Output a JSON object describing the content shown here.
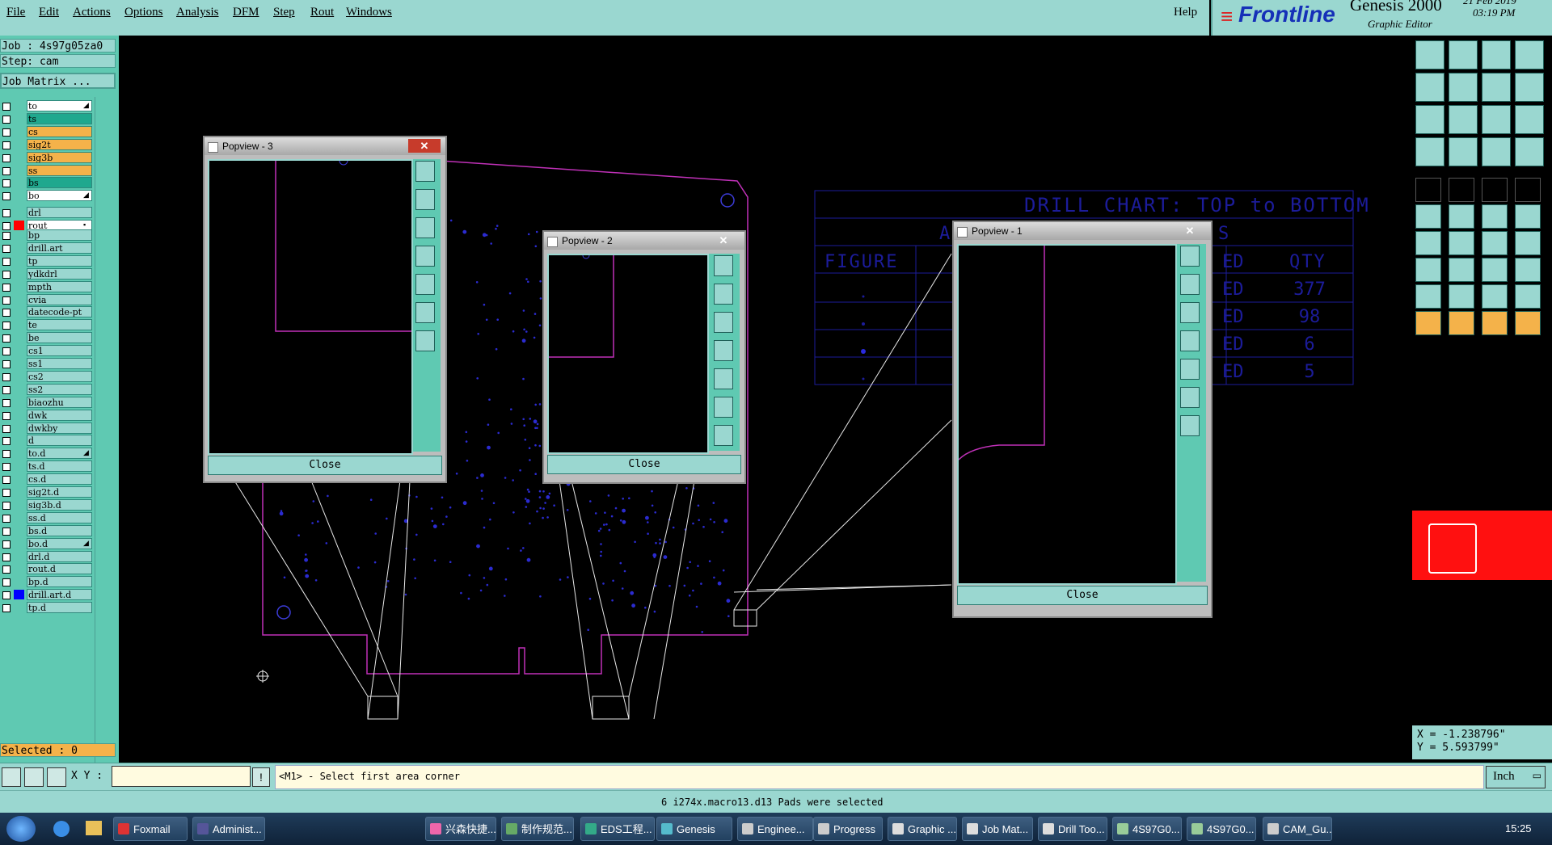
{
  "menubar": {
    "items": [
      "File",
      "Edit",
      "Actions",
      "Options",
      "Analysis",
      "DFM",
      "Step",
      "Rout",
      "Windows"
    ],
    "help": "Help"
  },
  "brand": {
    "logo": "Frontline",
    "product": "Genesis 2000",
    "subtitle": "Graphic Editor",
    "date": "21 Feb 2019",
    "time": "03:19 PM"
  },
  "left_panel": {
    "job": "Job : 4s97g05za0",
    "step": "Step: cam",
    "job_matrix": "Job Matrix ...",
    "selected": "Selected : 0",
    "layers_top": [
      {
        "name": "to",
        "color": "#ffffff",
        "marker": "◢"
      },
      {
        "name": "ts",
        "color": "#1fa88e"
      },
      {
        "name": "cs",
        "color": "#f4b24a"
      },
      {
        "name": "sig2t",
        "color": "#f4b24a"
      },
      {
        "name": "sig3b",
        "color": "#f4b24a"
      },
      {
        "name": "ss",
        "color": "#f4b24a"
      },
      {
        "name": "bs",
        "color": "#1fa88e"
      },
      {
        "name": "bo",
        "color": "#ffffff",
        "marker": "◢"
      }
    ],
    "layers_drill": [
      {
        "name": "drl",
        "color": "#9ad7d0"
      },
      {
        "name": "rout",
        "color": "#ffffff",
        "active": "#ff0000",
        "marker": "▪"
      }
    ],
    "layers_other": [
      {
        "name": "bp"
      },
      {
        "name": "drill.art"
      },
      {
        "name": "tp"
      },
      {
        "name": "ydkdrl"
      },
      {
        "name": "mpth"
      },
      {
        "name": "cvia"
      },
      {
        "name": "datecode-pt"
      },
      {
        "name": "te"
      },
      {
        "name": "be"
      },
      {
        "name": "cs1"
      },
      {
        "name": "ss1"
      },
      {
        "name": "cs2"
      },
      {
        "name": "ss2"
      },
      {
        "name": "biaozhu"
      },
      {
        "name": "dwk"
      },
      {
        "name": "dwkby"
      },
      {
        "name": "d"
      },
      {
        "name": "to.d",
        "marker": "◢"
      },
      {
        "name": "ts.d"
      },
      {
        "name": "cs.d"
      },
      {
        "name": "sig2t.d"
      },
      {
        "name": "sig3b.d"
      },
      {
        "name": "ss.d"
      },
      {
        "name": "bs.d"
      },
      {
        "name": "bo.d",
        "marker": "◢"
      },
      {
        "name": "drl.d"
      },
      {
        "name": "rout.d"
      },
      {
        "name": "bp.d"
      },
      {
        "name": "drill.art.d",
        "active": "#0000ff"
      },
      {
        "name": "tp.d"
      }
    ]
  },
  "drill_chart": {
    "title": "DRILL CHART: TOP to BOTTOM",
    "header_partial_left": "A",
    "header_partial_right": "S",
    "col_figure": "FIGURE",
    "col_ed": "ED",
    "col_qty": "QTY",
    "rows": [
      {
        "ed": "ED",
        "qty": "377"
      },
      {
        "ed": "ED",
        "qty": "98"
      },
      {
        "ed": "ED",
        "qty": "6"
      },
      {
        "ed": "ED",
        "qty": "5"
      }
    ]
  },
  "popviews": [
    {
      "title": "Popview - 3",
      "close": "Close"
    },
    {
      "title": "Popview - 2",
      "close": "Close"
    },
    {
      "title": "Popview - 1",
      "close": "Close"
    }
  ],
  "coords": {
    "x": "X = -1.238796\"",
    "y": "Y = 5.593799\""
  },
  "cmdbar": {
    "xy_label": "X Y :",
    "xy_value": "",
    "prompt": "<M1> - Select first area corner",
    "units": "Inch"
  },
  "status": "6 i274x.macro13.d13 Pads were selected",
  "taskbar": {
    "items": [
      "Foxmail",
      "Administ...",
      "兴森快捷...",
      "制作规范...",
      "EDS工程...",
      "Genesis",
      "Enginee...",
      "Progress",
      "Graphic ...",
      "Job Mat...",
      "Drill Too...",
      "4S97G0...",
      "4S97G0...",
      "CAM_Gu..."
    ],
    "clock": "15:25"
  }
}
